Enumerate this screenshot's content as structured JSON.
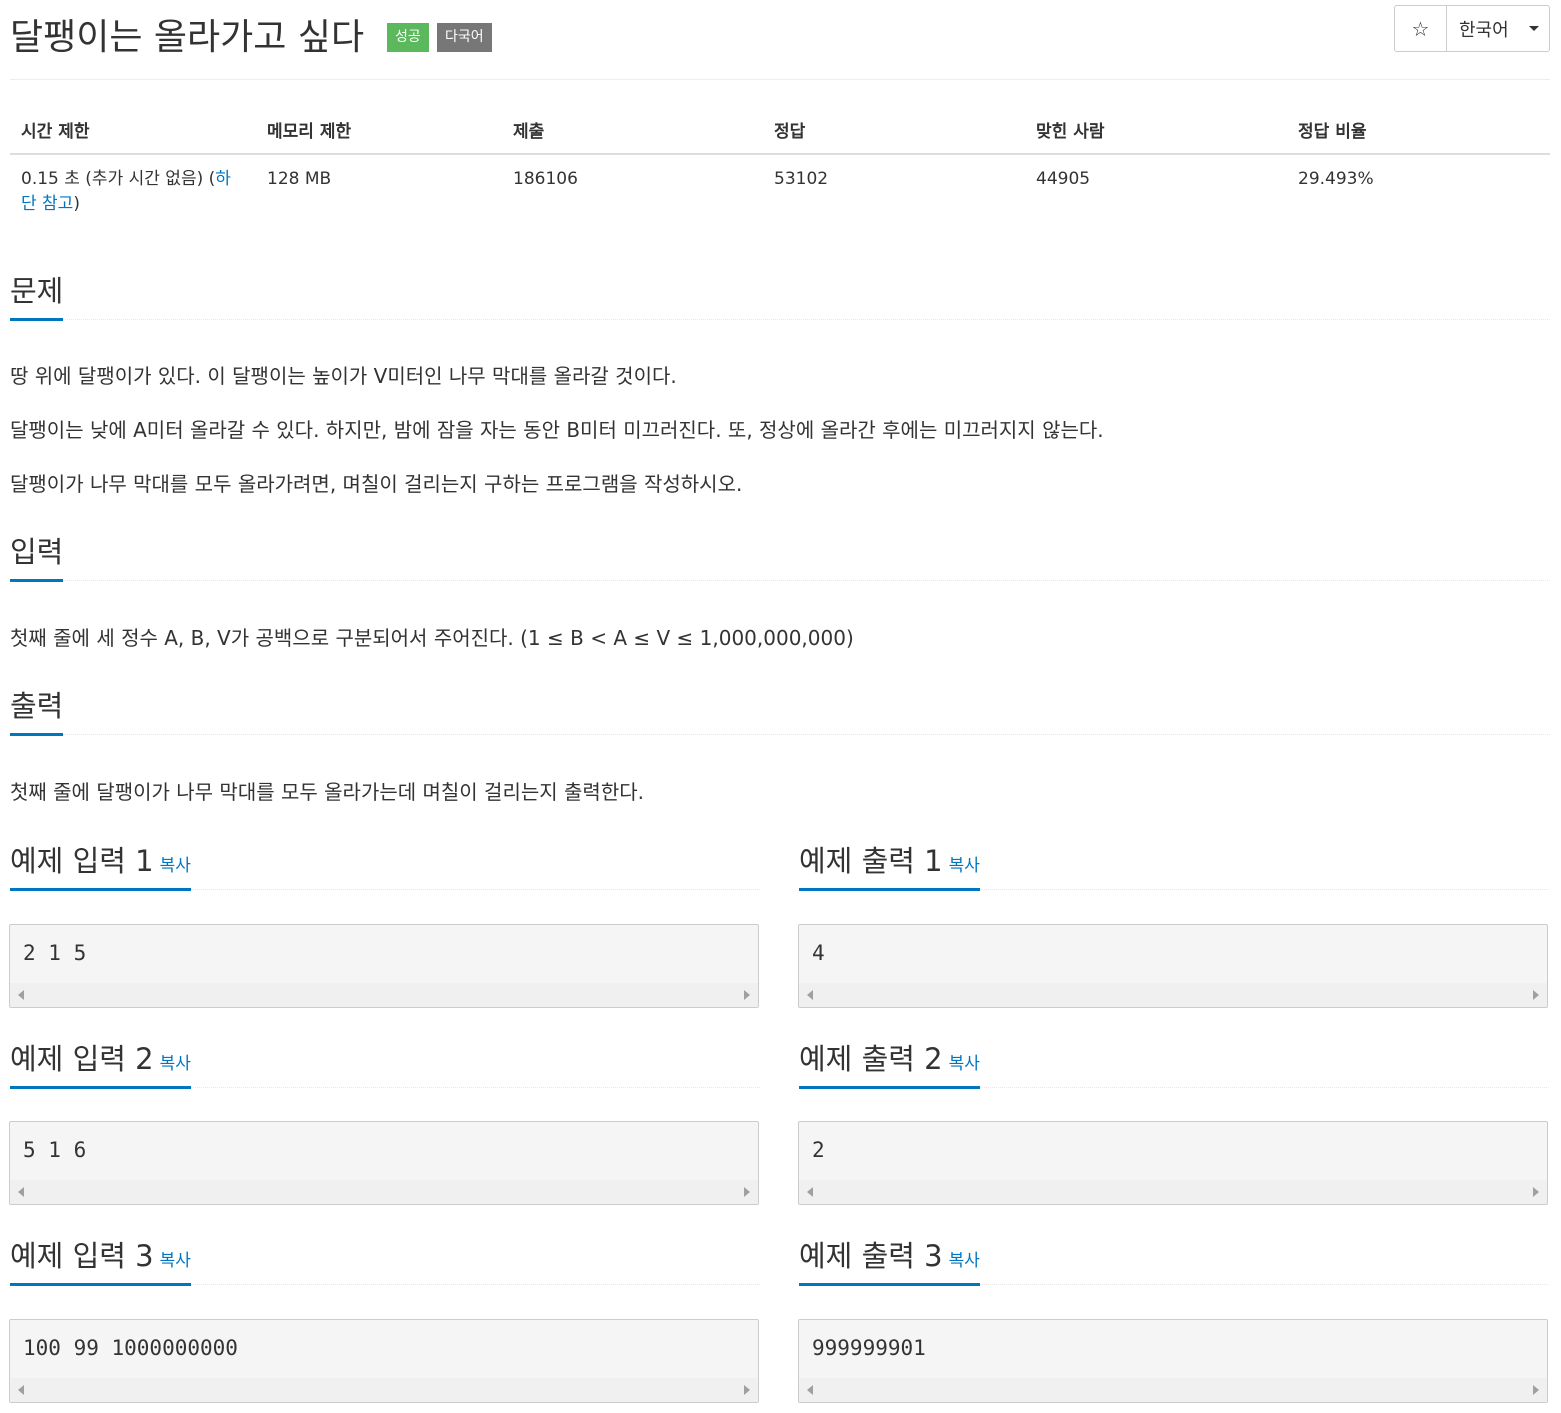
{
  "problem": {
    "title": "달팽이는 올라가고 싶다",
    "label_success": "성공",
    "label_multilang": "다국어"
  },
  "toolbar": {
    "star_icon": "☆",
    "language": "한국어"
  },
  "info_table": {
    "headers": [
      "시간 제한",
      "메모리 제한",
      "제출",
      "정답",
      "맞힌 사람",
      "정답 비율"
    ],
    "time_limit_text": "0.15 초 (추가 시간 없음) (",
    "time_limit_link": "하단 참고",
    "time_limit_close": ")",
    "memory_limit": "128 MB",
    "submissions": "186106",
    "accepted": "53102",
    "solved_users": "44905",
    "ratio": "29.493%"
  },
  "sections": {
    "problem_heading": "문제",
    "problem_paragraphs": [
      "땅 위에 달팽이가 있다. 이 달팽이는 높이가 V미터인 나무 막대를 올라갈 것이다.",
      "달팽이는 낮에 A미터 올라갈 수 있다. 하지만, 밤에 잠을 자는 동안 B미터 미끄러진다. 또, 정상에 올라간 후에는 미끄러지지 않는다.",
      "달팽이가 나무 막대를 모두 올라가려면, 며칠이 걸리는지 구하는 프로그램을 작성하시오."
    ],
    "input_heading": "입력",
    "input_paragraph": "첫째 줄에 세 정수 A, B, V가 공백으로 구분되어서 주어진다. (1 ≤ B < A ≤ V ≤ 1,000,000,000)",
    "output_heading": "출력",
    "output_paragraph": "첫째 줄에 달팽이가 나무 막대를 모두 올라가는데 며칠이 걸리는지 출력한다."
  },
  "samples": {
    "copy_label": "복사",
    "items": [
      {
        "input_title": "예제 입력 1",
        "input": "2 1 5",
        "output_title": "예제 출력 1",
        "output": "4"
      },
      {
        "input_title": "예제 입력 2",
        "input": "5 1 6",
        "output_title": "예제 출력 2",
        "output": "2"
      },
      {
        "input_title": "예제 입력 3",
        "input": "100 99 1000000000",
        "output_title": "예제 출력 3",
        "output": "999999901"
      }
    ]
  }
}
